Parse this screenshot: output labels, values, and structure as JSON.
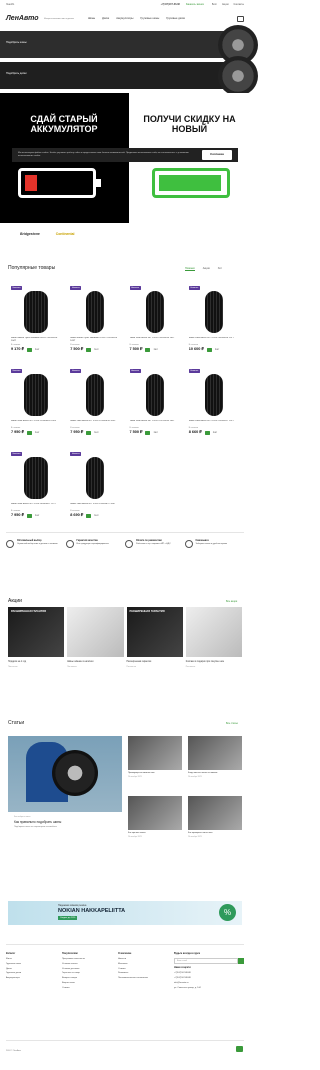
{
  "topbar": {
    "location": "Ленобл.",
    "phone": "+7(347)907-88-88",
    "callback": "Заказать звонок",
    "links": [
      "Блог",
      "Акции",
      "Контакты"
    ]
  },
  "header": {
    "logo": "ЛенАвто",
    "tagline": "Интернет-магазин шин и дисков",
    "nav": [
      "Шины",
      "Диски",
      "Аккумуляторы",
      "Грузовые шины",
      "Грузовые диски"
    ]
  },
  "hero": {
    "pick_tires": "Подобрать шины",
    "pick_disks": "Подобрать диски",
    "banner_left": "СДАЙ СТАРЫЙ АККУМУЛЯТОР",
    "banner_right": "ПОЛУЧИ СКИДКУ НА НОВЫЙ"
  },
  "cookie": {
    "text": "Мы используем файлы cookie. Чтобы улучшить работу сайта и предоставить вам больше возможностей. Продолжая использовать сайт, вы соглашаетесь с условиями использования cookie.",
    "button": "Согласен"
  },
  "brands": [
    "Bridgestone",
    "Continental"
  ],
  "popular": {
    "title": "Популярные товары",
    "tabs": [
      "Новинки",
      "Акция",
      "Хит"
    ],
    "active_tab": "Новинки",
    "products": [
      {
        "badge": "Новинка",
        "name": "Шина Nokian Tyres Nordman 8SUV 235/55R18 104T",
        "stock": "В наличии",
        "price": "9 170 ₽",
        "count": "1шт"
      },
      {
        "badge": "Новинка",
        "name": "Шина Nokian Tyres Nordman 8 SUV 225/55R19 103T",
        "stock": "В наличии",
        "price": "7 500 ₽",
        "count": "1шт"
      },
      {
        "badge": "Новинка",
        "name": "Шина Viatti Bosco NIT V-526 235/55R18 102T",
        "stock": "В наличии",
        "price": "7 500 ₽",
        "count": "1шт"
      },
      {
        "badge": "Новинка",
        "name": "Шина Viatti Bosco NIT V-526 235/60R18 107T",
        "stock": "В наличии",
        "price": "10 600 ₽",
        "count": "1шт"
      },
      {
        "badge": "Новинка",
        "name": "Шина Viatti Bosco NIT V-526 225/60R18 104V",
        "stock": "В наличии",
        "price": "7 950 ₽",
        "count": "1шт"
      },
      {
        "badge": "Новинка",
        "name": "Шина Viatti Bosco NIT V-526 225/60R18 104V",
        "stock": "В наличии",
        "price": "7 950 ₽",
        "count": "1шт"
      },
      {
        "badge": "Новинка",
        "name": "Шина Viatti Bosco NIT V-526 225/70R16 103T",
        "stock": "В наличии",
        "price": "7 500 ₽",
        "count": "1шт"
      },
      {
        "badge": "Новинка",
        "name": "Шина Viatti Bosco NIT V-526 225/65R17 102T",
        "stock": "В наличии",
        "price": "8 660 ₽",
        "count": "1шт"
      },
      {
        "badge": "Новинка",
        "name": "Шина Viatti Bosco NIT V-526 265/65R17 112T",
        "stock": "В наличии",
        "price": "7 950 ₽",
        "count": "1шт"
      },
      {
        "badge": "Новинка",
        "name": "Шина Viatti Bosco NIT V-526 235/65R17 108T",
        "stock": "В наличии",
        "price": "8 690 ₽",
        "count": "1шт"
      }
    ]
  },
  "features": [
    {
      "title": "Оптимальный выбор",
      "text": "Огромный выбор шин и дисков в наличии"
    },
    {
      "title": "Гарантия качества",
      "text": "Вся продукция сертифицирована"
    },
    {
      "title": "Оплата по реквизитам",
      "text": "Работаем с юр. лицами и ИП с НДС"
    },
    {
      "title": "Самовывоз",
      "text": "Заберите заказ в удобное время"
    }
  ],
  "promos": {
    "title": "Акции",
    "all": "Все акции",
    "items": [
      {
        "img": "РАСШИРЕННАЯ ГАРАНТИЯ",
        "caption": "Подарок на 1 год",
        "date": "Постоянно"
      },
      {
        "img": "",
        "caption": "Шины зимние в наличии",
        "date": "Постоянно"
      },
      {
        "img": "РАСШИРЕННАЯ ГАРАНТИЯ",
        "caption": "Расширенная гарантия",
        "date": "Постоянно"
      },
      {
        "img": "",
        "caption": "Колпаки в подарок при покупке шин",
        "date": "Постоянно"
      }
    ]
  },
  "articles": {
    "title": "Статьи",
    "all": "Все статьи",
    "main": {
      "tag": "Как выбрать шины",
      "title": "Как правильно подобрать шины",
      "text": "Подбираем шины по параметрам автомобиля"
    },
    "items": [
      {
        "t": "Преимущества зимних шин",
        "d": "24 октября 2023"
      },
      {
        "t": "Когда менять шины на зимние",
        "d": "24 октября 2023"
      },
      {
        "t": "Как хранить шины",
        "d": "24 октября 2023"
      },
      {
        "t": "Как проверить износ шин",
        "d": "24 октября 2023"
      },
      {
        "t": "Давление в шинах зимой",
        "d": "24 октября 2023"
      },
      {
        "t": "Правила шиномонтажа",
        "d": "24 октября 2023"
      }
    ]
  },
  "nokian_banner": {
    "line1": "Надежная зимняя резина",
    "line2": "NOKIAN HAKKAPELIITTA",
    "line3": "Скидка до 10%",
    "pct": "%"
  },
  "footer": {
    "cat": {
      "title": "Каталог",
      "items": [
        "Шины",
        "Грузовые шины",
        "Диски",
        "Грузовые диски",
        "Аккумуляторы"
      ]
    },
    "buyers": {
      "title": "Покупателям",
      "items": [
        "Программа лояльности",
        "Условия оплаты",
        "Условия доставки",
        "Гарантия на товар",
        "Возврат товара",
        "Вопрос-ответ",
        "Отзывы"
      ]
    },
    "company": {
      "title": "О магазине",
      "items": [
        "Новости",
        "Магазины",
        "Отзывы",
        "Реквизиты",
        "Пользовательское соглашение"
      ]
    },
    "subscribe": {
      "title": "Будьте всегда в курсе",
      "placeholder": "Ваш e-mail",
      "social": "Наши соцсети"
    },
    "contacts": {
      "phone": "+7(347)907-88-88",
      "phone2": "+7(347)907-88-88",
      "email": "info@lenavto.ru",
      "address": "ул. Советская улица, д. 144"
    },
    "copyright": "2024 © ЛенАвто"
  }
}
